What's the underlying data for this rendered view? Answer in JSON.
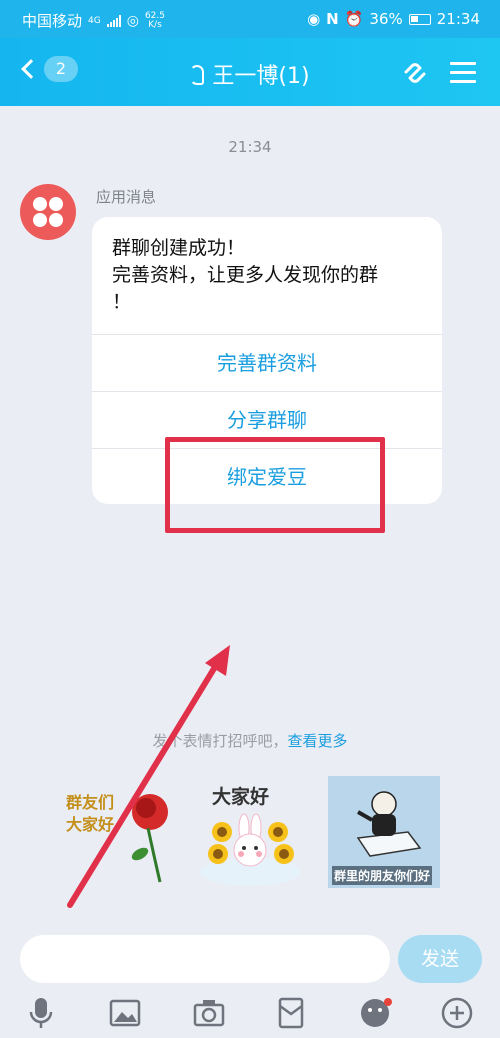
{
  "status_bar": {
    "carrier": "中国移动",
    "network": "4G",
    "speed_value": "62.5",
    "speed_unit": "K/s",
    "battery": "36%",
    "time": "21:34"
  },
  "header": {
    "unread_count": "2",
    "title": "王一博(1)"
  },
  "chat": {
    "timestamp": "21:34",
    "sender": "应用消息",
    "card": {
      "lines": [
        "群聊创建成功！",
        "完善资料，让更多人发现你的群",
        "！"
      ],
      "actions": [
        "完善群资料",
        "分享群聊",
        "绑定爱豆"
      ]
    }
  },
  "greeting": {
    "hint": "发个表情打招呼吧，",
    "more": "查看更多",
    "stickers": [
      {
        "icon": "rose-sticker-icon",
        "text": "群友们 大家好"
      },
      {
        "icon": "bunny-sunflower-sticker-icon",
        "text": "大家好"
      },
      {
        "icon": "ice-cube-meme-sticker-icon",
        "text": "群里的朋友你们好"
      }
    ]
  },
  "input": {
    "placeholder": "",
    "send_label": "发送"
  },
  "colors": {
    "accent": "#1fb5ec",
    "link": "#1a9ee0",
    "annotation": "#e0304a",
    "avatar": "#ec5a5a"
  }
}
